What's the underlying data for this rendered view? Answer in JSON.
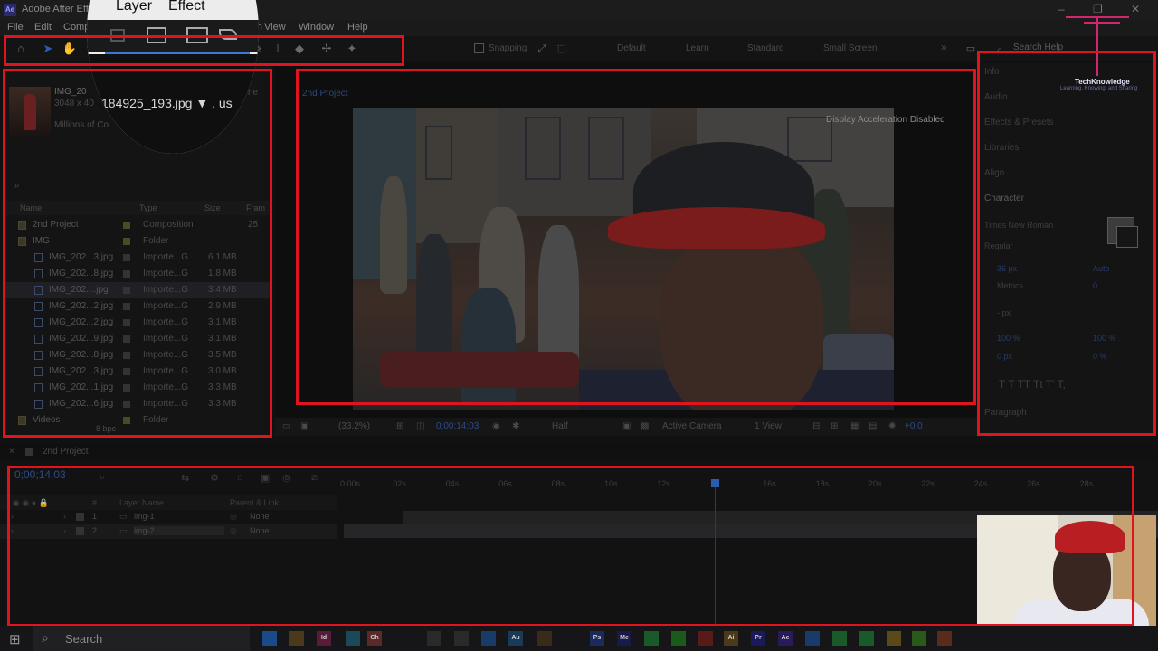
{
  "window": {
    "title": "Adobe After Effects",
    "controls": [
      "–",
      "❐",
      "✕"
    ]
  },
  "menu": [
    "File",
    "Edit",
    "Compo",
    "Layer",
    "Effect",
    "ation",
    "View",
    "Window",
    "Help"
  ],
  "magnifier": {
    "menu_layer": "Layer",
    "menu_effect": "Effect",
    "file_label": "184925_193.jpg ▼ , us"
  },
  "toolbar": {
    "snapping": "Snapping",
    "workspaces": [
      "Default",
      "Learn",
      "Standard",
      "Small Screen"
    ],
    "more": "»",
    "search_help": "Search Help"
  },
  "project": {
    "preview_name": "IMG_20",
    "preview_dims": "3048 x 40",
    "preview_colors": "Millions of Co",
    "preview_extra": "ne",
    "search_icon": "⌕",
    "columns": {
      "name": "Name",
      "type": "Type",
      "size": "Size",
      "frame": "Fram"
    },
    "rows": [
      {
        "name": "2nd Project",
        "type": "Composition",
        "size": "",
        "extra": "25",
        "kind": "comp"
      },
      {
        "name": "IMG",
        "type": "Folder",
        "size": "",
        "extra": "",
        "kind": "folder"
      },
      {
        "name": "IMG_202...3.jpg",
        "type": "Importe...G",
        "size": "6.1 MB",
        "extra": "",
        "kind": "file"
      },
      {
        "name": "IMG_202...8.jpg",
        "type": "Importe...G",
        "size": "1.8 MB",
        "extra": "",
        "kind": "file"
      },
      {
        "name": "IMG_202....jpg",
        "type": "Importe...G",
        "size": "3.4 MB",
        "extra": "",
        "kind": "file"
      },
      {
        "name": "IMG_202...2.jpg",
        "type": "Importe...G",
        "size": "2.9 MB",
        "extra": "",
        "kind": "file"
      },
      {
        "name": "IMG_202...2.jpg",
        "type": "Importe...G",
        "size": "3.1 MB",
        "extra": "",
        "kind": "file"
      },
      {
        "name": "IMG_202...9.jpg",
        "type": "Importe...G",
        "size": "3.1 MB",
        "extra": "",
        "kind": "file"
      },
      {
        "name": "IMG_202...8.jpg",
        "type": "Importe...G",
        "size": "3.5 MB",
        "extra": "",
        "kind": "file"
      },
      {
        "name": "IMG_202...3.jpg",
        "type": "Importe...G",
        "size": "3.0 MB",
        "extra": "",
        "kind": "file"
      },
      {
        "name": "IMG_202...1.jpg",
        "type": "Importe...G",
        "size": "3.3 MB",
        "extra": "",
        "kind": "file"
      },
      {
        "name": "IMG_202...6.jpg",
        "type": "Importe...G",
        "size": "3.3 MB",
        "extra": "",
        "kind": "file"
      },
      {
        "name": "Videos",
        "type": "Folder",
        "size": "",
        "extra": "",
        "kind": "folder"
      }
    ],
    "footer_bpc": "8 bpc"
  },
  "composition": {
    "tab": "2nd Project",
    "display_note": "Display Acceleration Disabled"
  },
  "viewer_bar": {
    "zoom": "(33.2%)",
    "timecode": "0;00;14;03",
    "resolution": "Half",
    "camera": "Active Camera",
    "views": "1 View",
    "offset": "+0.0"
  },
  "right_panel": {
    "sections": [
      "Info",
      "Audio",
      "Effects & Presets",
      "Libraries",
      "Align",
      "Character"
    ],
    "font": "Times New Roman",
    "style": "Regular",
    "size": "36 px",
    "leading": "Auto",
    "kerning": "Metrics",
    "tracking": "0",
    "stroke": "- px",
    "vscale": "100 %",
    "hscale": "100 %",
    "baseline": "0 px",
    "tsume": "0 %",
    "styles": "T  T  TT  Tt  T'  T,",
    "paragraph": "Paragraph"
  },
  "logo": {
    "name": "TechKnowledge",
    "tagline": "Learning, Knowing, and Sharing"
  },
  "timeline": {
    "tab": "2nd Project",
    "current_time": "0;00;14;03",
    "columns": {
      "layer_name": "Layer Name",
      "parent": "Parent & Link",
      "num": "#"
    },
    "layers": [
      {
        "num": "1",
        "name": "img-1",
        "parent": "None"
      },
      {
        "num": "2",
        "name": "img-2",
        "parent": "None"
      }
    ],
    "ruler_labels": [
      "0:00s",
      "02s",
      "04s",
      "06s",
      "08s",
      "10s",
      "12s",
      "",
      "16s",
      "18s",
      "20s",
      "22s",
      "24s",
      "26s",
      "28s"
    ],
    "playhead_seconds": 14.1
  },
  "taskbar": {
    "search": "Search",
    "apps": [
      "Ch",
      "Id",
      "Au",
      "Ps",
      "Me",
      "Ai",
      "Pr",
      "Ae"
    ]
  }
}
